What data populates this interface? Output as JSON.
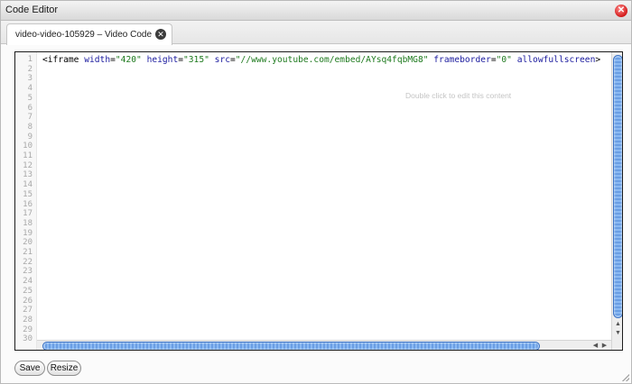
{
  "window": {
    "title": "Code Editor",
    "close_glyph": "✕"
  },
  "tab": {
    "label": "video-video-105929 – Video Code",
    "close_glyph": "✕"
  },
  "editor": {
    "line_numbers": [
      "1",
      "2",
      "3",
      "4",
      "5",
      "6",
      "7",
      "8",
      "9",
      "10",
      "11",
      "12",
      "13",
      "14",
      "15",
      "16",
      "17",
      "18",
      "19",
      "20",
      "21",
      "22",
      "23",
      "24",
      "25",
      "26",
      "27",
      "28",
      "29",
      "30"
    ],
    "code_tokens": {
      "open": "<iframe ",
      "attr_width": "width",
      "eq1": "=",
      "val_width": "\"420\"",
      "sp1": " ",
      "attr_height": "height",
      "eq2": "=",
      "val_height": "\"315\"",
      "sp2": " ",
      "attr_src": "src",
      "eq3": "=",
      "val_src": "\"//www.youtube.com/embed/AYsq4fqbMG8\"",
      "sp3": " ",
      "attr_frameborder": "frameborder",
      "eq4": "=",
      "val_frameborder": "\"0\"",
      "sp4": " ",
      "attr_allowfullscreen": "allowfullscreen",
      "close": ">"
    },
    "hint": "Double click to edit this content"
  },
  "buttons": {
    "save_label": "Save",
    "resize_label": "Resize"
  },
  "icons": {
    "scroll_up": "▲",
    "scroll_down": "▼",
    "scroll_left": "◀",
    "scroll_right": "▶"
  },
  "colors": {
    "attribute": "#1a1a9e",
    "string": "#1e7a1e",
    "scrollbar": "#6a9ee4"
  }
}
